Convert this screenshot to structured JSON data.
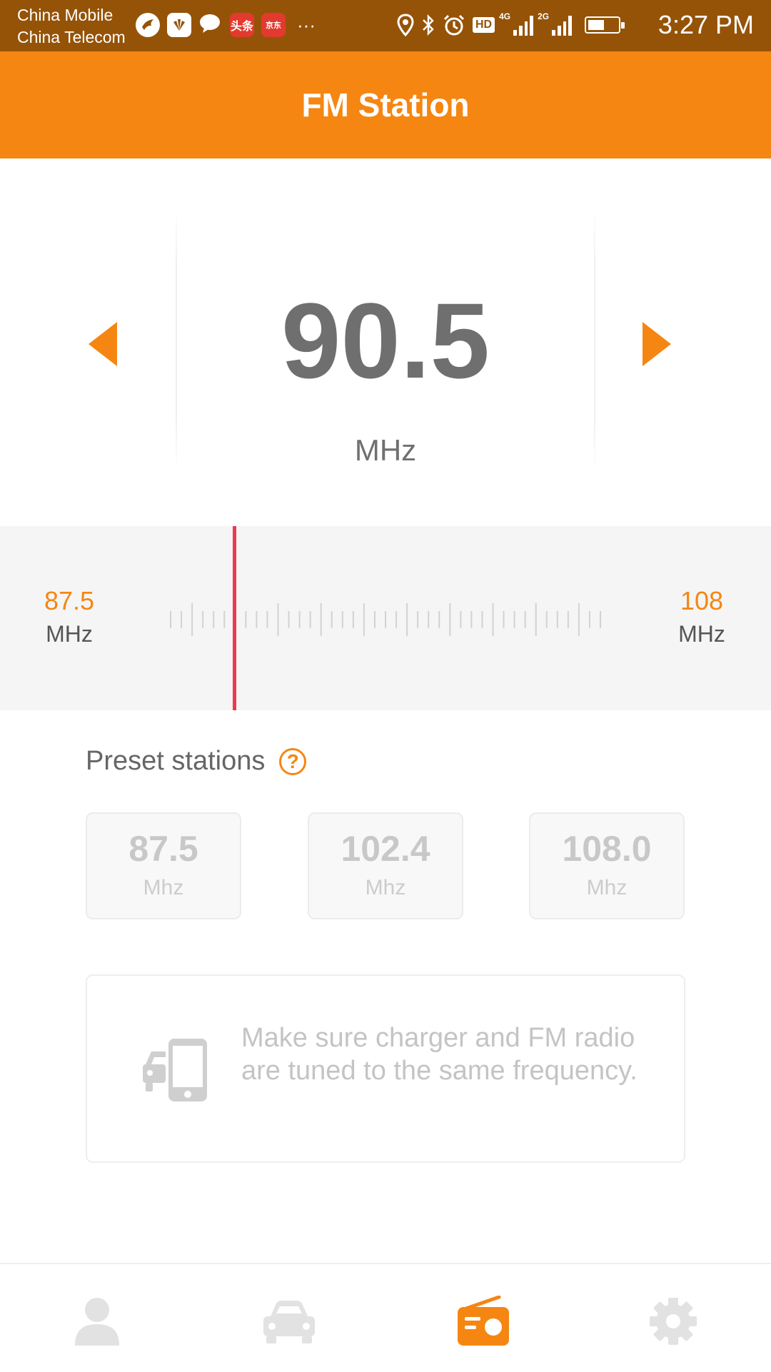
{
  "status_bar": {
    "carrier_1": "China Mobile",
    "carrier_2": "China Telecom",
    "notification_icons": [
      "bird-app-icon",
      "huawei-icon",
      "chat-bubble-icon",
      "toutiao-icon",
      "jd-icon"
    ],
    "toutiao_label": "头条",
    "jd_label": "京东",
    "overflow": "···",
    "system_icons": [
      "location-icon",
      "bluetooth-icon",
      "alarm-icon",
      "hd-icon",
      "signal-4g-icon",
      "signal-2g-icon",
      "battery-icon"
    ],
    "hd_label": "HD",
    "net_1": "4G",
    "net_2": "2G",
    "battery_level": 0.55,
    "time": "3:27 PM"
  },
  "header": {
    "title": "FM Station"
  },
  "tuner": {
    "frequency": "90.5",
    "unit": "MHz",
    "prev_icon": "triangle-left-icon",
    "next_icon": "triangle-right-icon"
  },
  "dial": {
    "min_value": "87.5",
    "min_unit": "MHz",
    "max_value": "108",
    "max_unit": "MHz",
    "current_position": 0.146
  },
  "presets": {
    "heading": "Preset stations",
    "help_symbol": "?",
    "items": [
      {
        "value": "87.5",
        "unit": "Mhz"
      },
      {
        "value": "102.4",
        "unit": "Mhz"
      },
      {
        "value": "108.0",
        "unit": "Mhz"
      }
    ]
  },
  "info": {
    "icon": "car-phone-icon",
    "text": "Make sure charger and FM radio are tuned to the same frequency."
  },
  "bottom_nav": {
    "tabs": [
      {
        "icon": "person-icon",
        "active": false
      },
      {
        "icon": "car-icon",
        "active": false
      },
      {
        "icon": "radio-icon",
        "active": true
      },
      {
        "icon": "gear-icon",
        "active": false
      }
    ]
  },
  "colors": {
    "status_bar": "#955308",
    "accent": "#f58612",
    "needle": "#ee3850",
    "inactive_icon": "#e2e2e2"
  }
}
